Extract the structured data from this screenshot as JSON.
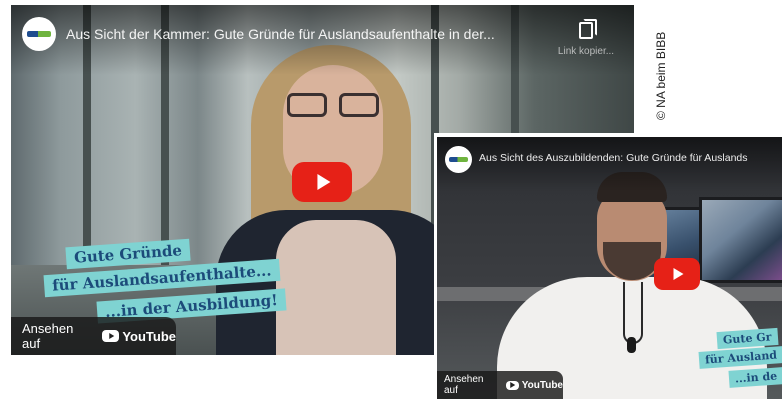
{
  "video1": {
    "title": "Aus Sicht der Kammer: Gute Gründe für Auslandsaufenthalte in der...",
    "copy_link_label": "Link kopier...",
    "caption_lines": [
      "Gute Gründe",
      "für Auslandsaufenthalte...",
      "...in der Ausbildung!"
    ],
    "watch_on_label": "Ansehen auf",
    "youtube_label": "YouTube"
  },
  "video2": {
    "title": "Aus Sicht des Auszubildenden: Gute Gründe für Auslands",
    "caption_lines": [
      "Gute Gr",
      "für Ausland",
      "...in de"
    ],
    "watch_on_label": "Ansehen auf",
    "youtube_label": "YouTube"
  },
  "credit": "© NA beim BIBB",
  "colors": {
    "play_red": "#e62117",
    "caption_bg": "#7fd3d2",
    "caption_text": "#1c4b7a"
  },
  "icons": [
    "channel-logo-icon",
    "copy-link-icon",
    "play-icon",
    "youtube-icon"
  ]
}
